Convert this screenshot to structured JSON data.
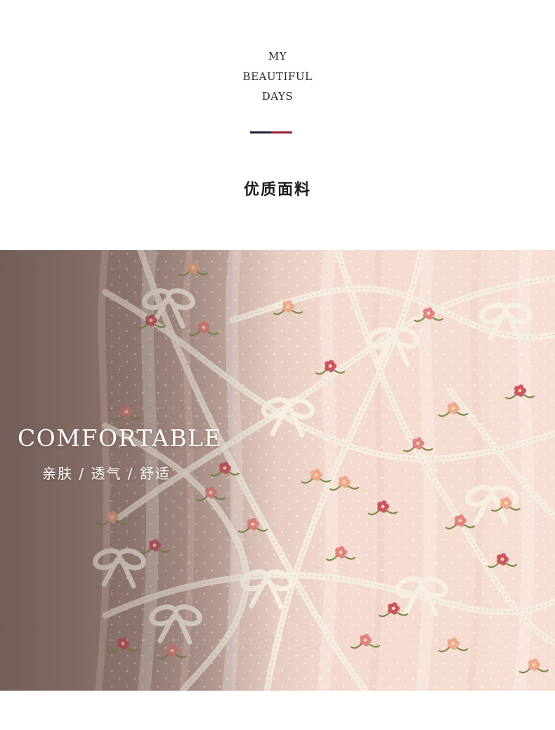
{
  "brand": {
    "lines": [
      "MY",
      "BEAUTIFUL",
      "DAYS"
    ]
  },
  "divider_colors": [
    "#1f2340",
    "#9a1f35"
  ],
  "section_title": "优质面料",
  "photo": {
    "headline": "COMFORTABLE",
    "subline": "亲肤 / 透气 / 舒适",
    "background_color": "#8a746e",
    "fabric_color": "#f5dcd2",
    "ribbon_color": "#f6efe2",
    "flower_colors": [
      "#e07a7e",
      "#f0a48a",
      "#c9485a",
      "#7e8a4a"
    ]
  }
}
